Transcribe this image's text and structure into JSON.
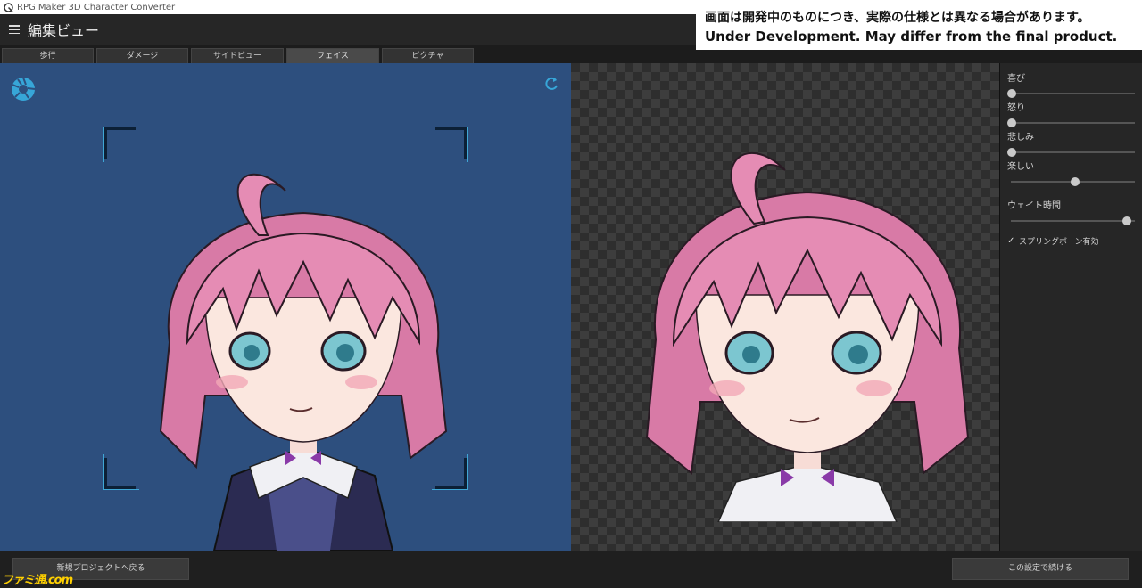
{
  "window": {
    "title": "RPG Maker 3D Character Converter"
  },
  "header": {
    "title": "編集ビュー"
  },
  "notice": {
    "jp": "画面は開発中のものにつき、実際の仕様とは異なる場合があります。",
    "en": "Under Development. May differ from the final product."
  },
  "tabs": [
    {
      "label": "歩行",
      "active": false
    },
    {
      "label": "ダメージ",
      "active": false
    },
    {
      "label": "サイドビュー",
      "active": false
    },
    {
      "label": "フェイス",
      "active": true
    },
    {
      "label": "ピクチャ",
      "active": false
    }
  ],
  "sidebar": {
    "sliders": [
      {
        "label": "喜び",
        "value_pct": 0
      },
      {
        "label": "怒り",
        "value_pct": 0
      },
      {
        "label": "悲しみ",
        "value_pct": 0
      },
      {
        "label": "楽しい",
        "value_pct": 55
      }
    ],
    "wait_slider": {
      "label": "ウェイト時間",
      "value_pct": 100
    },
    "spring_bone": {
      "label": "スプリングボーン有効",
      "checked": true
    }
  },
  "footer": {
    "back_label": "新規プロジェクトへ戻る",
    "continue_label": "この設定で続ける"
  },
  "watermark": {
    "text": "ファミ通.com"
  },
  "colors": {
    "left_bg": "#2d4f7e",
    "accent": "#3fa7d6",
    "hair": "#e58cb4"
  }
}
